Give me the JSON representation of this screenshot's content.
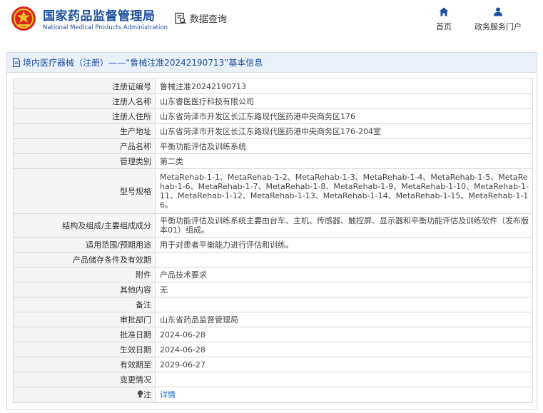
{
  "header": {
    "brand_cn": "国家药品监督管理局",
    "brand_en": "National Medical Products Administration",
    "query_label": "数据查询",
    "nav": [
      {
        "label": "首页",
        "icon": "home-icon"
      },
      {
        "label": "政务服务门户",
        "icon": "user-icon"
      }
    ],
    "colors": {
      "brand": "#1e4f9d",
      "accent": "#1e6ec8",
      "emblem_red": "#d9261c",
      "emblem_gold": "#f2c12e"
    }
  },
  "panel": {
    "title": "境内医疗器械（注册）——“鲁械注准20242190713”基本信息"
  },
  "record": {
    "rows": [
      {
        "label": "注册证编号",
        "value": "鲁械注准20242190713"
      },
      {
        "label": "注册人名称",
        "value": "山东睿医医疗科技有限公司"
      },
      {
        "label": "注册人住所",
        "value": "山东省菏泽市开发区长江东路现代医药港中央商务区176"
      },
      {
        "label": "生产地址",
        "value": "山东省菏泽市开发区长江东路现代医药港中央商务区176-204室"
      },
      {
        "label": "产品名称",
        "value": "平衡功能评估及训练系统"
      },
      {
        "label": "管理类别",
        "value": "第二类"
      },
      {
        "label": "型号规格",
        "value": "MetaRehab-1-1、MetaRehab-1-2、MetaRehab-1-3、MetaRehab-1-4、MetaRehab-1-5、MetaRehab-1-6、MetaRehab-1-7、MetaRehab-1-8、MetaRehab-1-9、MetaRehab-1-10、MetaRehab-1-11、MetaRehab-1-12、MetaRehab-1-13、MetaRehab-1-14、MetaRehab-1-15、MetaRehab-1-16。"
      },
      {
        "label": "结构及组成/主要组成成分",
        "value": "平衡功能评估及训练系统主要由台车、主机、传感器、触控屏、显示器和平衡功能评估及训练软件（发布版本01）组成。"
      },
      {
        "label": "适用范围/预期用途",
        "value": "用于对患者平衡能力进行评估和训练。"
      },
      {
        "label": "产品储存条件及有效期",
        "value": ""
      },
      {
        "label": "附件",
        "value": "产品技术要求"
      },
      {
        "label": "其他内容",
        "value": "无"
      },
      {
        "label": "备注",
        "value": ""
      },
      {
        "label": "审批部门",
        "value": "山东省药品监督管理局"
      },
      {
        "label": "批准日期",
        "value": "2024-06-28"
      },
      {
        "label": "生效日期",
        "value": "2024-06-28"
      },
      {
        "label": "有效期至",
        "value": "2029-06-27"
      },
      {
        "label": "变更情况",
        "value": ""
      }
    ],
    "note_row": {
      "label": "注",
      "icon": "info-bulb-icon",
      "link": "详情"
    }
  }
}
